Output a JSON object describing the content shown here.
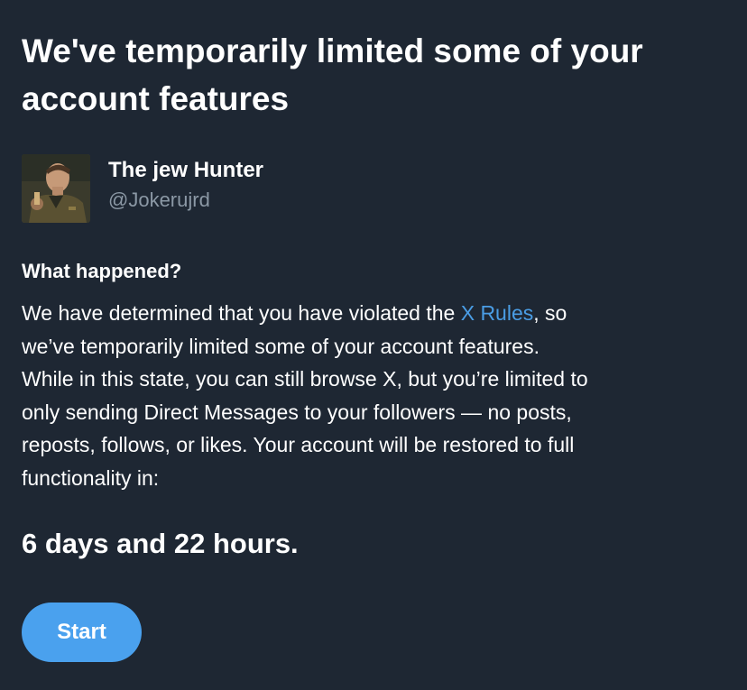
{
  "header": {
    "title": "We've temporarily limited some of your account features"
  },
  "account": {
    "display_name": "The jew Hunter",
    "handle": "@Jokerujrd",
    "avatar_icon": "profile-photo"
  },
  "notice": {
    "heading": "What happened?",
    "lines": {
      "line1_before_link": "We have determined that you have violated the ",
      "link_text": "X Rules",
      "line1_after_link": ", so",
      "line2": "we’ve temporarily limited some of your account features.",
      "line3": "While in this state, you can still browse X, but you’re limited to",
      "line4": "only sending Direct Messages to your followers — no posts,",
      "line5": "reposts, follows, or likes. Your account will be restored to full",
      "line6": "functionality in:"
    },
    "countdown": "6 days and 22 hours."
  },
  "actions": {
    "start_label": "Start"
  },
  "colors": {
    "background": "#1e2733",
    "text": "#ffffff",
    "secondary_text": "#8b98a5",
    "link": "#4a9de5",
    "button": "#4aa1ee"
  }
}
